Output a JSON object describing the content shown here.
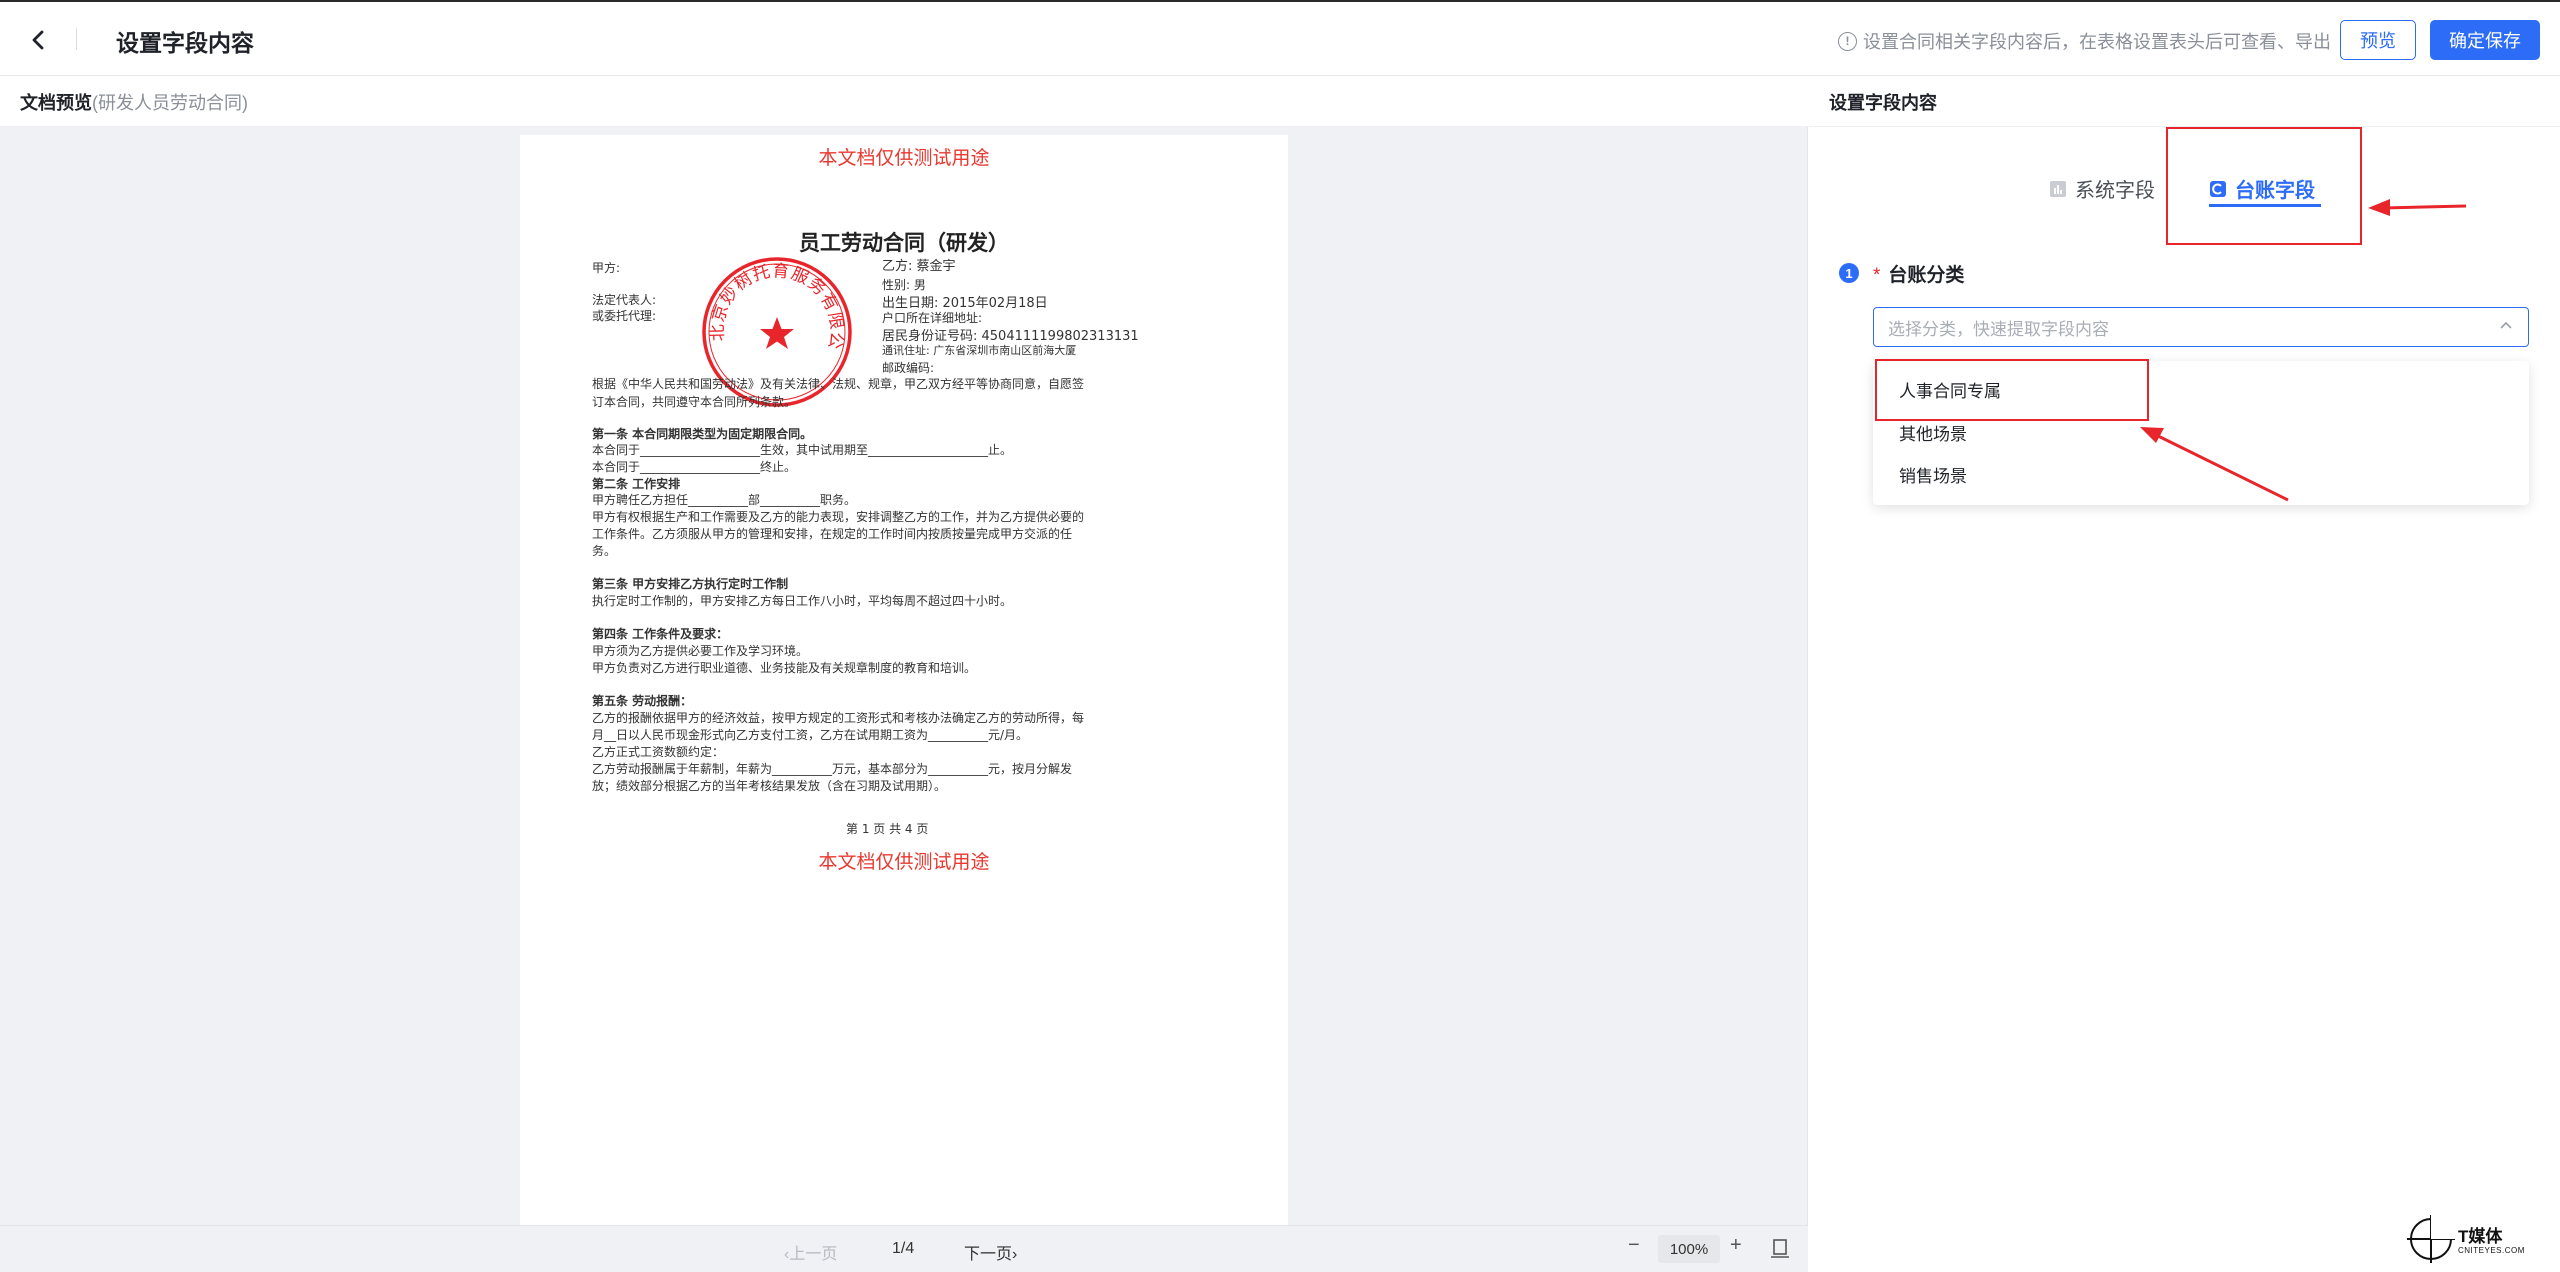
{
  "header": {
    "title": "设置字段内容",
    "hint": "设置合同相关字段内容后，在表格设置表头后可查看、导出",
    "preview_label": "预览",
    "save_label": "确定保存"
  },
  "left": {
    "head_title": "文档预览",
    "head_sub": "(研发人员劳动合同)",
    "watermark": "本文档仅供测试用途",
    "doc_title": "员工劳动合同（研发）",
    "seal_text": "北京妙树托育服务有限公司",
    "lines": {
      "party_a": "甲方:",
      "legal_rep": "法定代表人:",
      "agent": "或委托代理:",
      "party_b": "乙方:  蔡金宇",
      "gender": "性别:  男",
      "birth": "出生日期: 2015年02月18日",
      "address": "户口所在详细地址:",
      "id_no": "居民身份证号码: 4504111199802313131",
      "contact": "通讯住址: 广东省深圳市南山区前海大厦",
      "postcode": "邮政编码:",
      "intro1": "根据《中华人民共和国劳动法》及有关法律、法规、规章，甲乙双方经平等协商同意，自愿签",
      "intro2": "订本合同，共同遵守本合同所列条款。",
      "a1": "第一条   本合同期限类型为固定期限合同。",
      "a1_1": "本合同于____________________生效，其中试用期至____________________止。",
      "a1_2": "本合同于____________________终止。",
      "a2": "第二条  工作安排",
      "a2_1": "甲方聘任乙方担任__________部__________职务。",
      "a2_2": "甲方有权根据生产和工作需要及乙方的能力表现，安排调整乙方的工作，并为乙方提供必要的",
      "a2_3": "工作条件。乙方须服从甲方的管理和安排，在规定的工作时间内按质按量完成甲方交派的任",
      "a2_4": "务。",
      "a3": "第三条  甲方安排乙方执行定时工作制",
      "a3_1": "执行定时工作制的，甲方安排乙方每日工作八小时，平均每周不超过四十小时。",
      "a4": "第四条  工作条件及要求：",
      "a4_1": "甲方须为乙方提供必要工作及学习环境。",
      "a4_2": "甲方负责对乙方进行职业道德、业务技能及有关规章制度的教育和培训。",
      "a5": "第五条   劳动报酬：",
      "a5_1": "乙方的报酬依据甲方的经济效益，按甲方规定的工资形式和考核办法确定乙方的劳动所得，每",
      "a5_2": "月__日以人民币现金形式向乙方支付工资，乙方在试用期工资为__________元/月。",
      "a5_3": "乙方正式工资数额约定：",
      "a5_4": "乙方劳动报酬属于年薪制，年薪为__________万元，基本部分为__________元，按月分解发",
      "a5_5": "放；绩效部分根据乙方的当年考核结果发放（含在习期及试用期）。",
      "page_footer": "第 1 页 共 4 页"
    },
    "pager": {
      "prev": "上一页",
      "page": "1/4",
      "next": "下一页",
      "zoom": "100%",
      "minus": "−",
      "plus": "+"
    }
  },
  "right": {
    "head_title": "设置字段内容",
    "tab_system": "系统字段",
    "tab_ledger": "台账字段",
    "step": "1",
    "field_label": "台账分类",
    "required_mark": "*",
    "select_placeholder": "选择分类，快速提取字段内容",
    "options": [
      "人事合同专属",
      "其他场景",
      "销售场景"
    ]
  },
  "logo": {
    "name": "T媒体",
    "sub": "CNITEYES.COM"
  },
  "colors": {
    "accent": "#2d6cf6",
    "annotation": "#e8252b",
    "watermark": "#e8382f"
  }
}
